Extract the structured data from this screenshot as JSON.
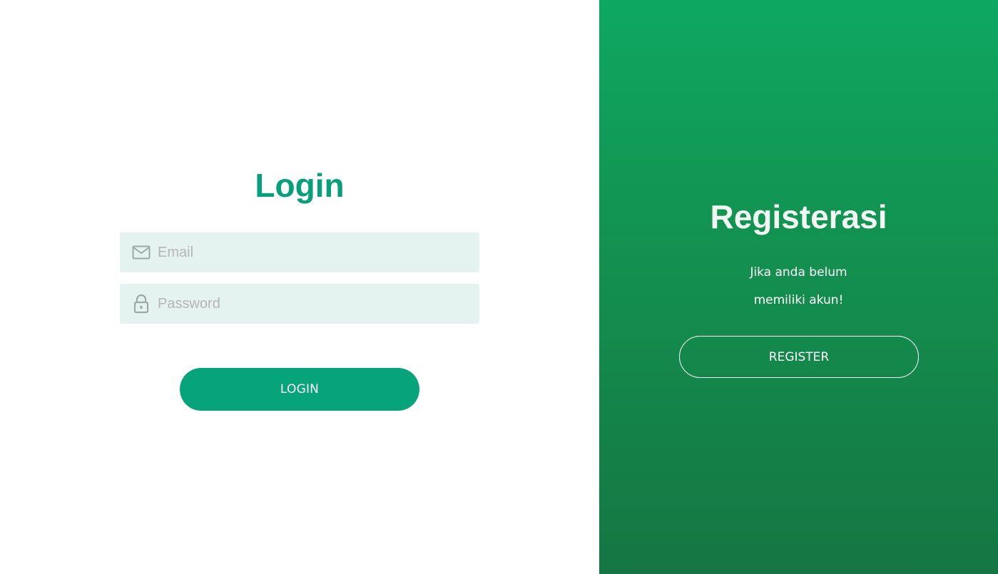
{
  "login": {
    "title": "Login",
    "email": {
      "placeholder": "Email",
      "value": "",
      "icon": "envelope-icon"
    },
    "password": {
      "placeholder": "Password",
      "value": "",
      "icon": "lock-icon"
    },
    "button_label": "LOGIN",
    "accent_color": "#07a07a"
  },
  "register": {
    "title": "Registerasi",
    "line1": "Jika anda belum",
    "line2": "memiliki akun!",
    "button_label": "REGISTER",
    "panel_color_top": "#0ea862",
    "panel_color_bottom": "#157643"
  }
}
